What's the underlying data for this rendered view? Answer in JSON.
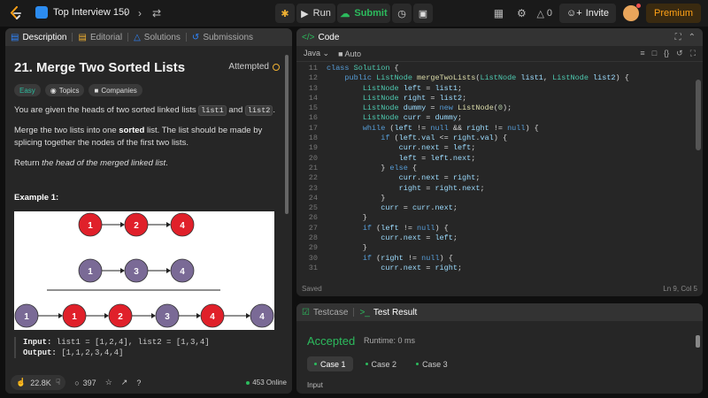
{
  "topbar": {
    "problem_list": "Top Interview 150",
    "run_label": "Run",
    "submit_label": "Submit",
    "streak_count": "0",
    "invite_label": "Invite",
    "premium_label": "Premium"
  },
  "left_tabs": [
    {
      "label": "Description"
    },
    {
      "label": "Editorial"
    },
    {
      "label": "Solutions"
    },
    {
      "label": "Submissions"
    }
  ],
  "problem": {
    "title": "21. Merge Two Sorted Lists",
    "status": "Attempted",
    "tags": [
      "Easy",
      "Topics",
      "Companies"
    ],
    "p1_a": "You are given the heads of two sorted linked lists ",
    "p1_k1": "list1",
    "p1_b": " and ",
    "p1_k2": "list2",
    "p1_c": ".",
    "p2_a": "Merge the two lists into one ",
    "p2_bold": "sorted",
    "p2_b": " list. The list should be made by splicing together the nodes of the first two lists.",
    "p3_a": "Return ",
    "p3_it": "the head of the merged linked list",
    "p3_b": ".",
    "example_heading": "Example 1:",
    "input_label": "Input:",
    "input_value": " list1 = [1,2,4], list2 = [1,3,4]",
    "output_label": "Output:",
    "output_value": " [1,1,2,3,4,4]"
  },
  "diagram": {
    "list1": [
      "1",
      "2",
      "4"
    ],
    "list2": [
      "1",
      "3",
      "4"
    ],
    "merged": [
      "1",
      "1",
      "2",
      "3",
      "4",
      "4"
    ],
    "red": "#e0202a",
    "purple": "#7a6a96"
  },
  "left_footer": {
    "likes": "22.8K",
    "comments": "397",
    "online": "453 Online"
  },
  "code_panel": {
    "title": "Code",
    "language": "Java",
    "mode": "Auto",
    "saved": "Saved",
    "cursor": "Ln 9, Col 5",
    "line_numbers": [
      "11",
      "12",
      "13",
      "14",
      "15",
      "16",
      "17",
      "18",
      "19",
      "20",
      "21",
      "22",
      "23",
      "24",
      "25",
      "26",
      "27",
      "28",
      "29",
      "30",
      "31"
    ]
  },
  "result_panel": {
    "tab_testcase": "Testcase",
    "tab_result": "Test Result",
    "status": "Accepted",
    "runtime": "Runtime: 0 ms",
    "cases": [
      "Case 1",
      "Case 2",
      "Case 3"
    ],
    "input_label": "Input"
  }
}
